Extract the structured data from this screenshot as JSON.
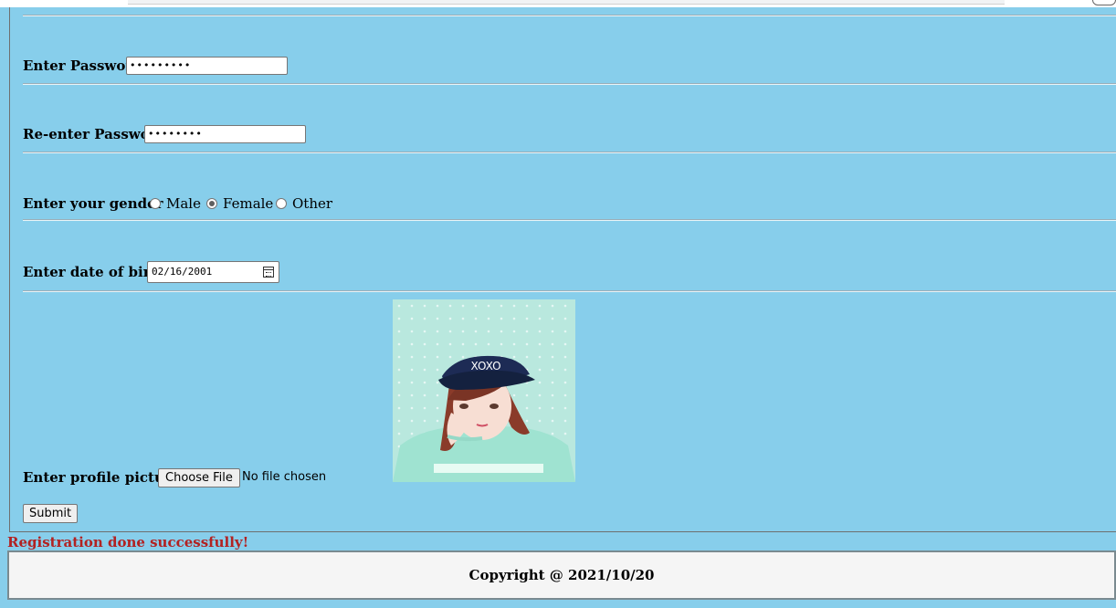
{
  "form": {
    "password": {
      "label": "Enter Password",
      "value": "•••••••••"
    },
    "reenter_password": {
      "label": "Re-enter Password",
      "value": "••••••••"
    },
    "gender": {
      "label": "Enter your gender",
      "options": [
        {
          "label": "Male",
          "checked": false
        },
        {
          "label": "Female",
          "checked": true
        },
        {
          "label": "Other",
          "checked": false
        }
      ]
    },
    "dob": {
      "label": "Enter date of birth",
      "value": "02/16/2001",
      "icon": "calendar-icon"
    },
    "profile_picture": {
      "label": "Enter profile picture",
      "button_label": "Choose File",
      "status": "No file chosen",
      "preview_cap_text": "XOXO"
    },
    "submit_label": "Submit"
  },
  "messages": {
    "success": "Registration done successfully!"
  },
  "footer": {
    "copyright": "Copyright @ 2021/10/20"
  },
  "colors": {
    "page_bg": "#87ceeb",
    "success_text": "#b22222",
    "footer_bg": "#f5f5f5"
  }
}
